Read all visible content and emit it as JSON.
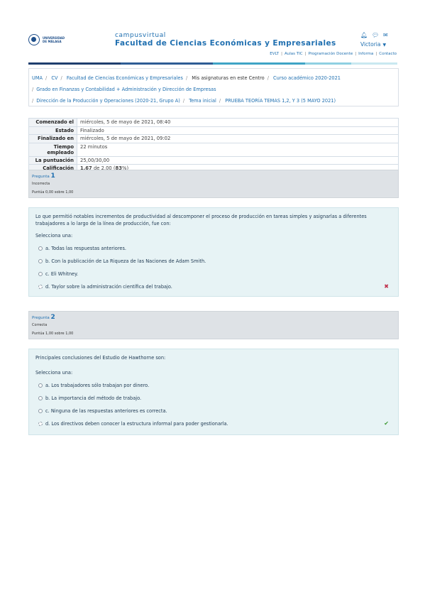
{
  "header": {
    "logo_text_line1": "UNIVERSIDAD",
    "logo_text_line2": "DE MÁLAGA",
    "kicker": "campusvirtual",
    "title": "Facultad de Ciencias Económicas y Empresariales",
    "user_name": "Victoria",
    "icons": [
      "bell-icon",
      "chat-icon",
      "mail-icon"
    ],
    "links": [
      "EVLT",
      "Aulas TIC",
      "Programación Docente",
      "Informa",
      "Contacto"
    ],
    "colorbar": [
      "#1f3e6e",
      "#1f3e6e",
      "#2f5d95",
      "#2f5d95",
      "#3fa4c6",
      "#3fa4c6",
      "#8fd0e2",
      "#c9e8f0"
    ]
  },
  "breadcrumb": {
    "line1": [
      "UMA",
      "CV",
      "Facultad de Ciencias Económicas y Empresariales",
      "Mis asignaturas en este Centro",
      "Curso académico 2020-2021"
    ],
    "line2": [
      "Grado en Finanzas y Contabilidad + Administración y Dirección de Empresas"
    ],
    "line3": [
      "Dirección de la Producción y Operaciones (2020-21, Grupo A)",
      "Tema inicial",
      "PRUEBA TEORÍA TEMAS 1,2, Y 3 (5 MAYO 2021)"
    ]
  },
  "summary": {
    "started_label": "Comenzado el",
    "started_value": "miércoles, 5 de mayo de 2021, 08:40",
    "state_label": "Estado",
    "state_value": "Finalizado",
    "finished_label": "Finalizado en",
    "finished_value": "miércoles, 5 de mayo de 2021, 09:02",
    "time_label_1": "Tiempo",
    "time_label_2": "empleado",
    "time_value": "22 minutos",
    "score_label": "La puntuación",
    "score_value": "25,00/30,00",
    "grade_label": "Calificación",
    "grade_main": "1,67",
    "grade_rest": " de 2,00 (",
    "grade_pct": "83",
    "grade_end": "%)"
  },
  "questions": [
    {
      "label": "Pregunta",
      "number": "1",
      "state": "Incorrecta",
      "grade": "Puntúa 0,00 sobre 1,00",
      "text": "Lo que permitió notables incrementos de productividad al descomponer el proceso de producción en tareas simples y asignarlas a diferentes trabajadores a lo largo de la línea de producción, fue con:",
      "prompt": "Selecciona una:",
      "answers": [
        "a. Todas las respuestas anteriores.",
        "b. Con la publicación de La Riqueza de las Naciones de Adam Smith.",
        "c. Eli Whitney.",
        "d. Taylor sobre la administración científica del trabajo."
      ],
      "mark": "✖"
    },
    {
      "label": "Pregunta",
      "number": "2",
      "state": "Correcta",
      "grade": "Puntúa 1,00 sobre 1,00",
      "text": "Principales conclusiones del Estudio de Hawthorne son:",
      "prompt": "Selecciona una:",
      "answers": [
        "a. Los trabajadores sólo trabajan por dinero.",
        "b. La importancia del método de trabajo.",
        "c. Ninguna de las respuestas anteriores es correcta.",
        "d. Los directivos deben conocer la estructura informal para poder gestionarla."
      ],
      "mark": "✔"
    }
  ]
}
